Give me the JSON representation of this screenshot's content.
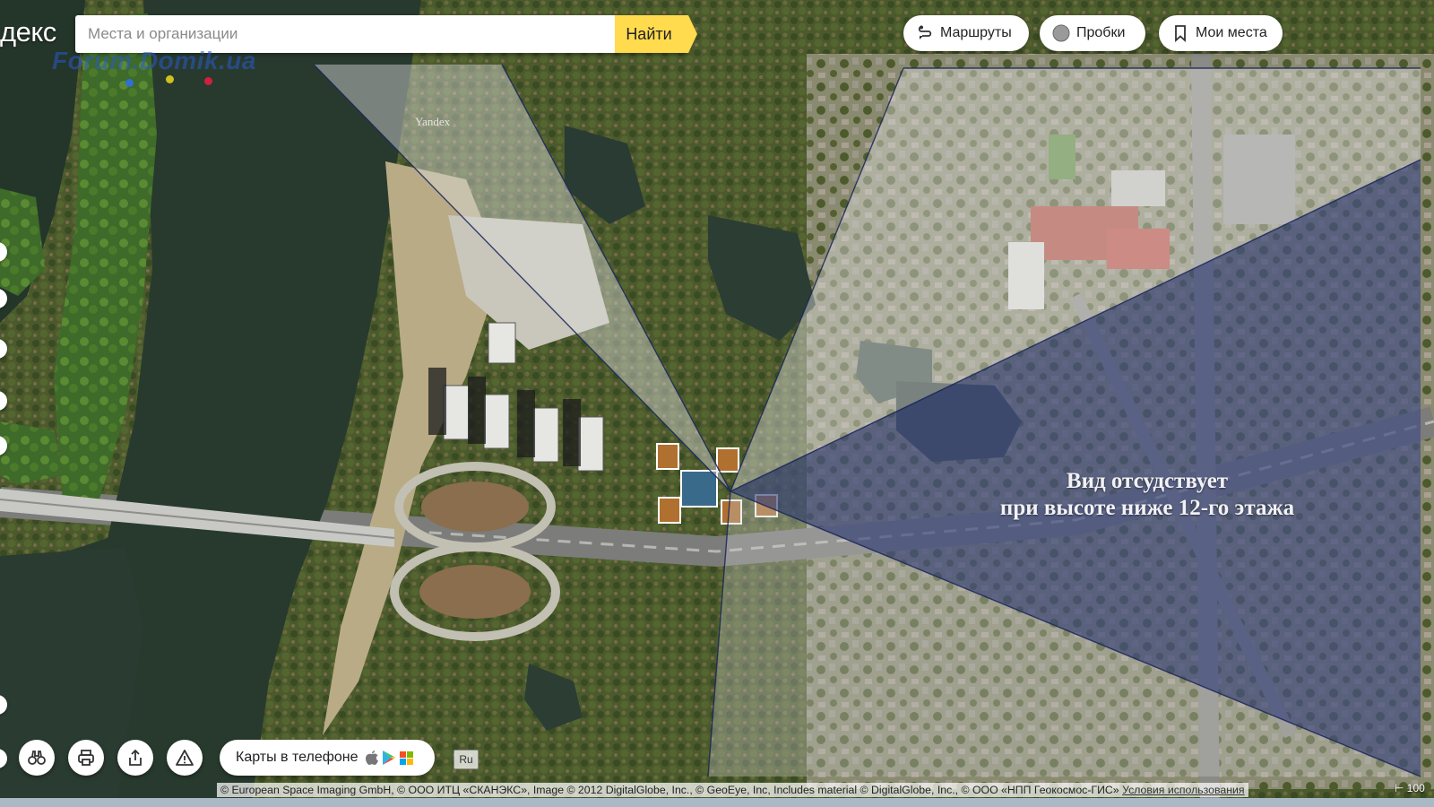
{
  "header": {
    "logo_fragment": "декс",
    "search": {
      "placeholder": "Места и организации",
      "value": ""
    },
    "search_button": "Найти",
    "routes_label": "Маршруты",
    "traffic_label": "Пробки",
    "my_places_label": "Мои места"
  },
  "watermark": {
    "text": "Forum.Domik.ua",
    "map_label": "Yandex"
  },
  "overlay": {
    "line1": "Вид отсудствует",
    "line2": "при высоте ниже 12-го этажа"
  },
  "bottom": {
    "phone_label": "Карты в телефоне",
    "lang": "Ru",
    "icons": [
      "panorama-icon",
      "print-icon",
      "share-icon",
      "warning-icon"
    ]
  },
  "copyright": {
    "text": "© European Space Imaging GmbH, © ООО ИТЦ «СКАНЭКС», Image © 2012 DigitalGlobe, Inc., © GeoEye, Inc, Includes material © DigitalGlobe, Inc., © ООО «НПП Геокосмос-ГИС»",
    "terms": "Условия использования",
    "scale": "100"
  },
  "colors": {
    "accent_yellow": "#ffdb4d",
    "overlay_white": "#d9d9de",
    "overlay_blue": "#1e2d6e",
    "watermark_blue": "#2858c8"
  }
}
